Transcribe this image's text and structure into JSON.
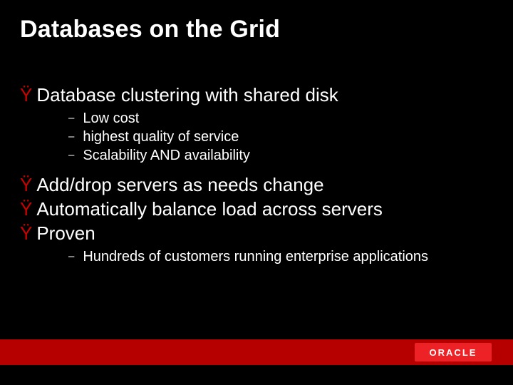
{
  "title": "Databases on the Grid",
  "bullets": [
    {
      "text": "Database clustering with shared disk",
      "subs": [
        "Low cost",
        "highest quality of service",
        "Scalability AND availability"
      ]
    },
    {
      "text": "Add/drop servers as needs change",
      "subs": []
    },
    {
      "text": "Automatically balance load across servers",
      "subs": []
    },
    {
      "text": "Proven",
      "subs": [
        "Hundreds of customers running enterprise applications"
      ]
    }
  ],
  "bullet_glyph": "Ÿ",
  "sub_glyph": "–",
  "logo_text": "ORACLE"
}
